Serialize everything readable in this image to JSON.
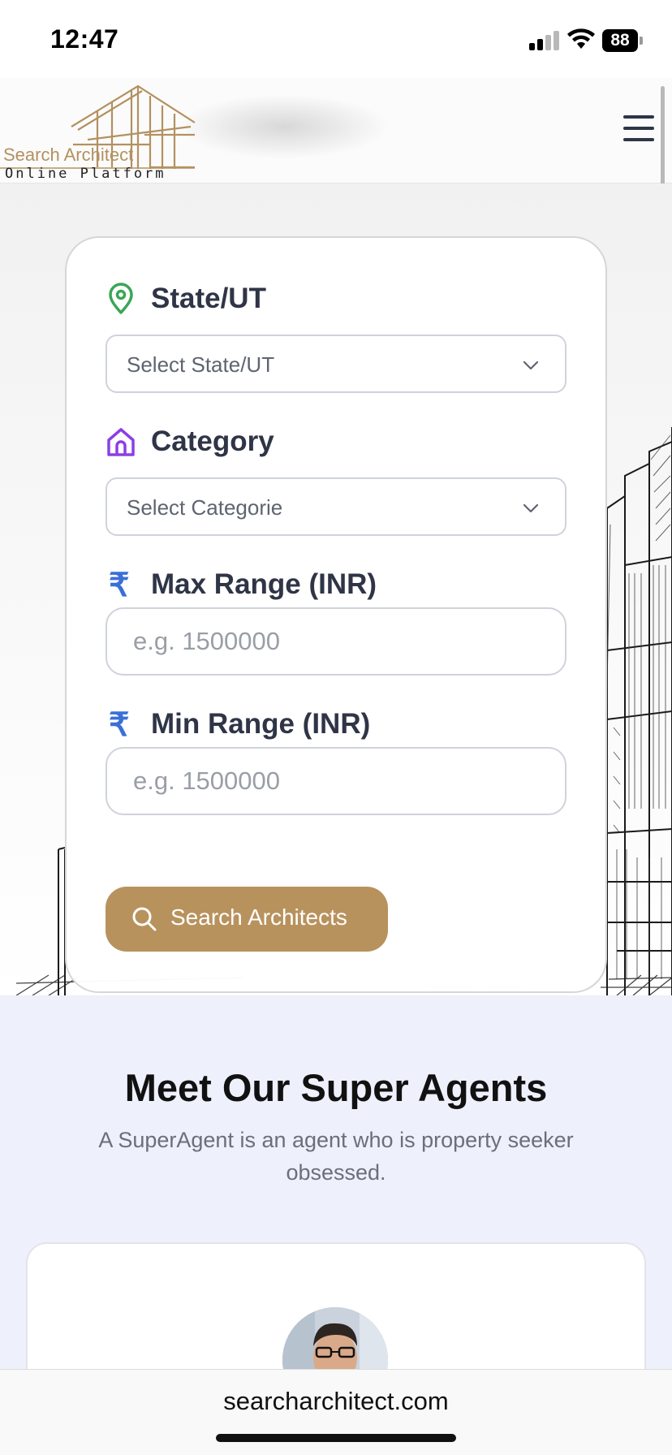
{
  "status_bar": {
    "time": "12:47",
    "battery": "88",
    "icons": [
      "cellular-signal-icon",
      "wifi-icon",
      "battery-icon"
    ]
  },
  "header": {
    "logo_title": "Search Architect",
    "logo_subtitle": "Online Platform",
    "menu_icon": "hamburger-menu-icon"
  },
  "search_form": {
    "state": {
      "label": "State/UT",
      "icon": "map-pin-icon",
      "icon_color": "#3aa655",
      "placeholder": "Select State/UT"
    },
    "category": {
      "label": "Category",
      "icon": "home-icon",
      "icon_color": "#8b3fe6",
      "placeholder": "Select Categorie"
    },
    "max_range": {
      "label": "Max Range (INR)",
      "icon_glyph": "₹",
      "placeholder": "e.g. 1500000"
    },
    "min_range": {
      "label": "Min Range (INR)",
      "icon_glyph": "₹",
      "placeholder": "e.g. 1500000"
    },
    "search_button": "Search Architects",
    "button_color": "#b8925d"
  },
  "agents_section": {
    "title": "Meet Our Super Agents",
    "subtitle": "A SuperAgent is an agent who is property seeker obsessed.",
    "background_color": "#eef0fb"
  },
  "browser": {
    "url": "searcharchitect.com"
  }
}
